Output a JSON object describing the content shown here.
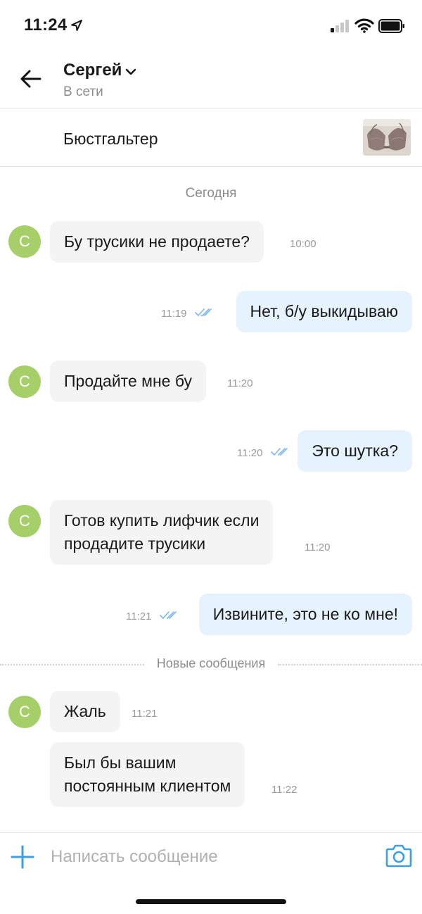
{
  "status_bar": {
    "time": "11:24"
  },
  "header": {
    "contact_name": "Сергей",
    "contact_status": "В сети"
  },
  "item": {
    "title": "Бюстгальтер"
  },
  "chat": {
    "date_separator": "Сегодня",
    "avatar_letter": "С",
    "new_messages_label": "Новые сообщения",
    "messages": [
      {
        "direction": "in",
        "text": "Бу трусики не продаете?",
        "time": "10:00"
      },
      {
        "direction": "out",
        "text": "Нет, б/у выкидываю",
        "time": "11:19"
      },
      {
        "direction": "in",
        "text": "Продайте мне бу",
        "time": "11:20"
      },
      {
        "direction": "out",
        "text": "Это шутка?",
        "time": "11:20"
      },
      {
        "direction": "in",
        "line1": "Готов купить лифчик если",
        "line2": "продадите трусики",
        "time": "11:20"
      },
      {
        "direction": "out",
        "text": "Извините, это не ко мне!",
        "time": "11:21"
      },
      {
        "direction": "in",
        "text": "Жаль",
        "time": "11:21"
      },
      {
        "direction": "in",
        "line1": "Был бы вашим",
        "line2": "постоянным клиентом",
        "time": "11:22"
      }
    ]
  },
  "composer": {
    "placeholder": "Написать сообщение"
  },
  "colors": {
    "avatar": "#a6cf6a",
    "outgoing_bubble": "#e6f2fd",
    "incoming_bubble": "#f4f4f4",
    "accent": "#3a9ee8"
  }
}
